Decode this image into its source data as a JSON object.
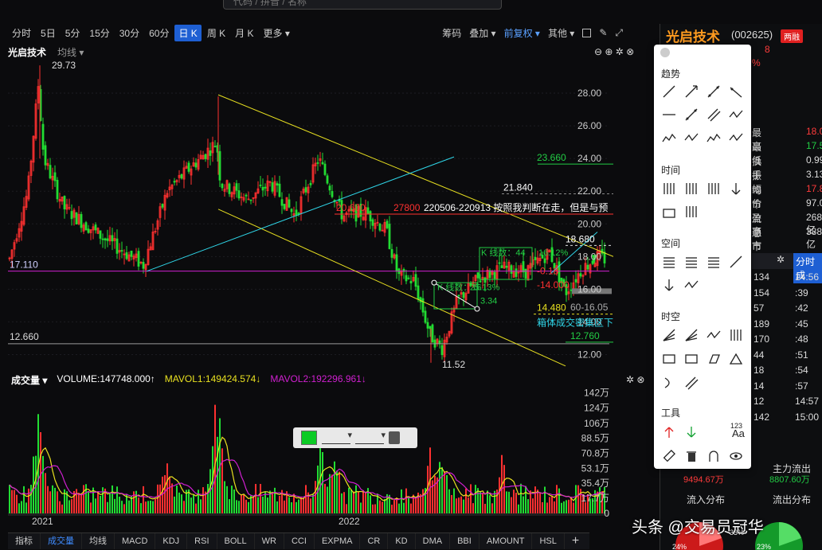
{
  "search": {
    "placeholder": "代码 / 拼音 / 名称"
  },
  "periods": [
    "分时",
    "5日",
    "5分",
    "15分",
    "30分",
    "60分",
    "日 K",
    "周 K",
    "月 K",
    "更多"
  ],
  "active_period": "日 K",
  "toolbar_right": {
    "chips": "筹码",
    "overlay": "叠加",
    "adjust": "前复权",
    "other": "其他"
  },
  "title": {
    "stock": "光启技术",
    "ma": "均线"
  },
  "price_axis": [
    "28.00",
    "26.00",
    "24.00",
    "22.00",
    "20.00",
    "18.00",
    "16.00",
    "14.00",
    "12.00"
  ],
  "price_labels": {
    "high": "29.73",
    "low": "11.52",
    "level_a": "17.110",
    "level_b": "12.660",
    "l2366": "23.660",
    "l2184": "21.840",
    "l2060": "20.600",
    "l2780": "27800",
    "l1868": "18.680",
    "l1400": "-14.000",
    "l1448": "14.480",
    "l1605": "60-16.05",
    "l1276": "12.760",
    "l018": "-0.18"
  },
  "annotations": {
    "note": "220506-220913 按照我判断在走，但是与预",
    "kcount_a": "K 线数：44",
    "pct_a": "16.12%",
    "kcount_b": "K 线数：16",
    "pct_b": "25.13%",
    "diff_b": "3.34",
    "box_note": "箱体成交密集区下"
  },
  "volume": {
    "label": "成交量",
    "vol": "VOLUME:147748.000↑",
    "mavol1": "MAVOL1:149424.574↓",
    "mavol2": "MAVOL2:192296.961↓",
    "axis": [
      "142万",
      "124万",
      "106万",
      "88.5万",
      "70.8万",
      "53.1万",
      "35.4万",
      "17.7万",
      "0"
    ]
  },
  "x_axis": {
    "y2021": "2021",
    "y2022": "2022"
  },
  "tabs": [
    "指标",
    "成交量",
    "均线",
    "MACD",
    "KDJ",
    "RSI",
    "BOLL",
    "WR",
    "CCI",
    "EXPMA",
    "CR",
    "KD",
    "DMA",
    "BBI",
    "AMOUNT",
    "HSL"
  ],
  "active_tab": "成交量",
  "palette": {
    "trend": "趋势",
    "time": "时间",
    "space": "空间",
    "spacetime": "时空",
    "tools": "工具",
    "text_tool": "Aa",
    "num_tool": "123"
  },
  "quote": {
    "name": "光启技术",
    "code": "(002625)",
    "badge": "两融",
    "partial1": "8",
    "partial2": "%",
    "rows": [
      {
        "label": "最高",
        "value": "18.0",
        "color": "red"
      },
      {
        "label": "最低",
        "value": "17.5",
        "color": "green"
      },
      {
        "label": "换手",
        "value": "0.99",
        "color": "white"
      },
      {
        "label": "振幅",
        "value": "3.13",
        "color": "white"
      },
      {
        "label": "均价",
        "value": "17.8",
        "color": "red"
      },
      {
        "label": "市盈率",
        "value": "97.0",
        "color": "white"
      },
      {
        "label": "流通市值",
        "value": "268亿",
        "color": "white"
      },
      {
        "label": "总市值",
        "value": "388亿",
        "color": "white"
      }
    ],
    "fenshi": "分时成",
    "ticks": [
      {
        "a": "134",
        "b": "14:56"
      },
      {
        "a": "154",
        "b": ":39"
      },
      {
        "a": "57",
        "b": ":42"
      },
      {
        "a": "189",
        "b": ":45"
      },
      {
        "a": "170",
        "b": ":48"
      },
      {
        "a": "44",
        "b": ":51"
      },
      {
        "a": "18",
        "b": ":54"
      },
      {
        "a": "14",
        "b": ":57"
      },
      {
        "a": "12",
        "b": "14:57"
      },
      {
        "a": "142",
        "b": "15:00"
      }
    ],
    "main_out_label": "主力流出",
    "main_in_value": "9494.67万",
    "main_out_value": "8807.60万",
    "flow_in": "流入分布",
    "flow_out": "流出分布",
    "pie_a": "33%",
    "pie_b": "23%",
    "pie_c": "24%"
  },
  "watermark": "头条 @交易员冠华",
  "colors": {
    "up": "#ff3030",
    "down": "#22dd33",
    "yellow": "#e8e020",
    "cyan": "#2fd6e8",
    "magenta": "#d020d0",
    "accent": "#1e5fd3"
  }
}
